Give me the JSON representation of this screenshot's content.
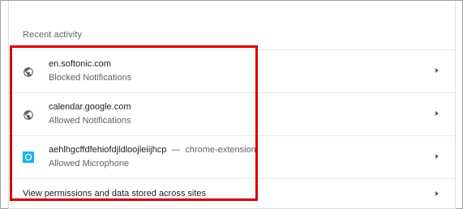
{
  "section": {
    "title": "Recent activity"
  },
  "activity": [
    {
      "site": "en.softonic.com",
      "status": "Blocked Notifications",
      "icon": "globe-icon"
    },
    {
      "site": "calendar.google.com",
      "status": "Allowed Notifications",
      "icon": "globe-icon"
    },
    {
      "site": "aehlhgcffdfehiofdjldloojleiijhcp",
      "separator": "—",
      "source": "chrome-extension",
      "status": "Allowed Microphone",
      "icon": "extension-icon"
    }
  ],
  "footer_link": {
    "label": "View permissions and data stored across sites"
  },
  "colors": {
    "highlight": "#d50000",
    "extension_icon": "#1ab5e8",
    "text_primary": "#202124",
    "text_secondary": "#5f6368"
  }
}
